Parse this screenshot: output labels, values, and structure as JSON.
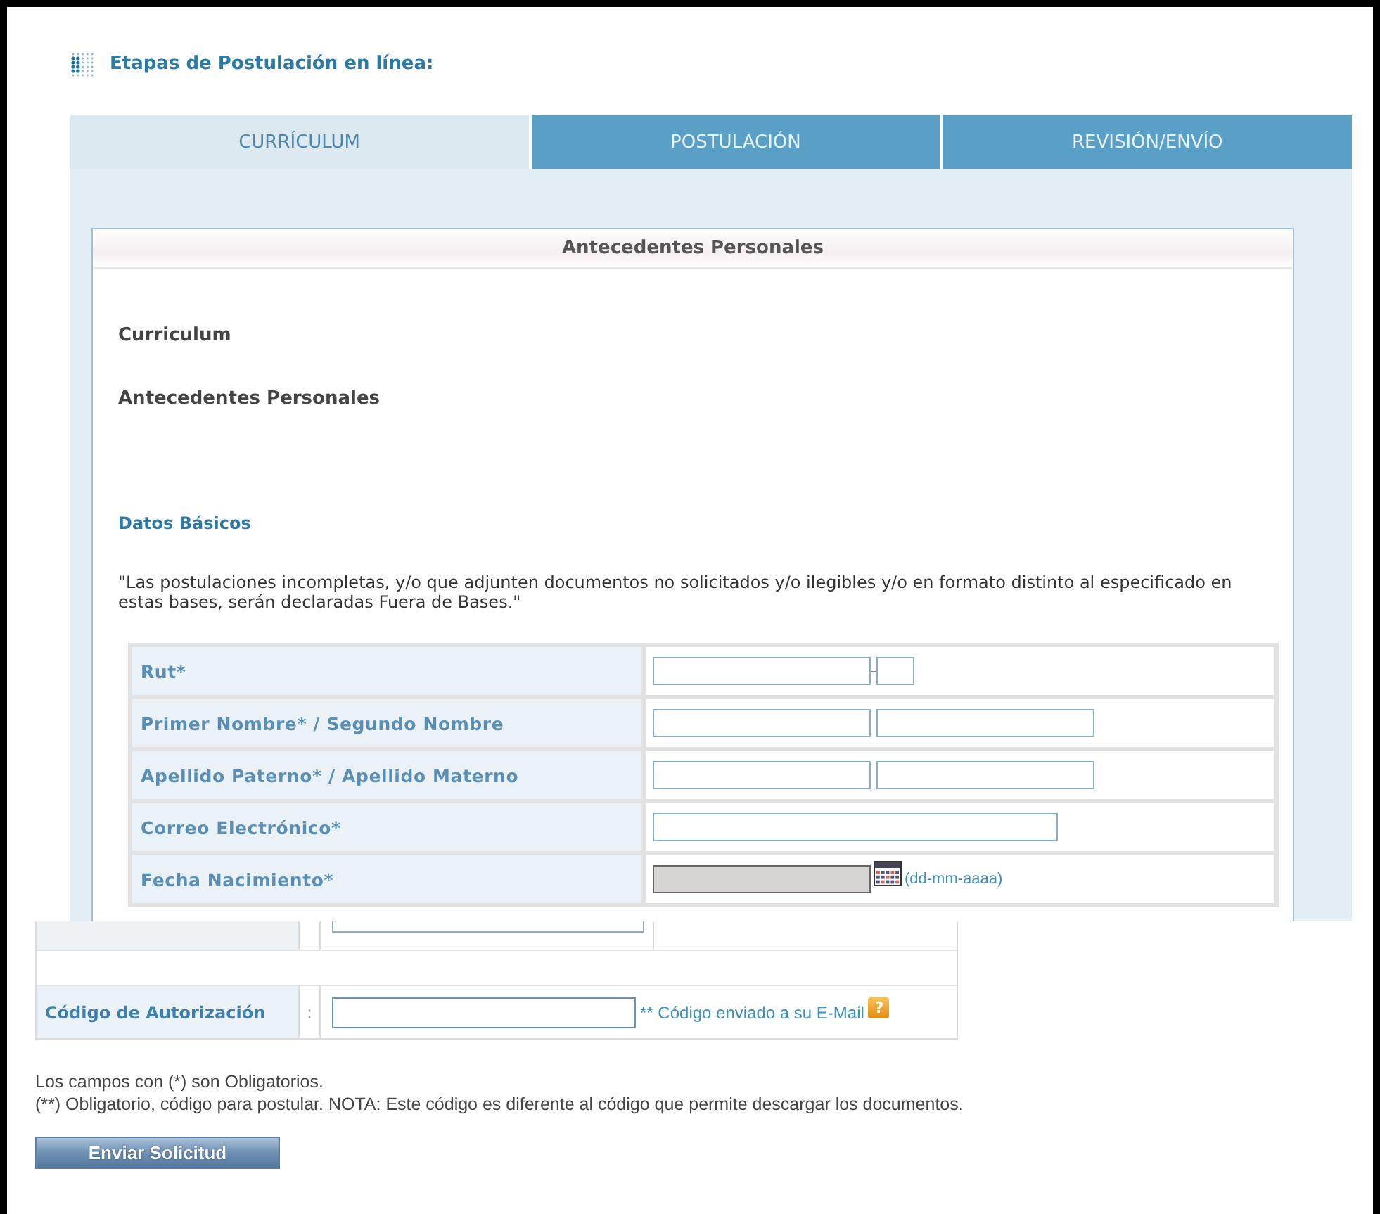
{
  "title": "Etapas de Postulación en línea:",
  "tabs": [
    {
      "label": "CURRÍCULUM",
      "selected": true
    },
    {
      "label": "POSTULACIÓN",
      "selected": false
    },
    {
      "label": "REVISIÓN/ENVÍO",
      "selected": false
    }
  ],
  "section_header": "Antecedentes Personales",
  "headings": [
    "Curriculum",
    "Antecedentes Personales"
  ],
  "subsection": "Datos Básicos",
  "notice": "\"Las postulaciones incompletas, y/o que adjunten documentos no solicitados y/o ilegibles y/o en formato distinto al especificado en estas bases, serán declaradas Fuera de Bases.\"",
  "fields": [
    {
      "label": "Rut*",
      "kind": "rut",
      "disabled": false
    },
    {
      "label": "Primer Nombre* / Segundo Nombre",
      "kind": "pair",
      "disabled": false
    },
    {
      "label": "Apellido Paterno* / Apellido Materno",
      "kind": "pair",
      "disabled": false
    },
    {
      "label": "Correo Electrónico*",
      "kind": "single",
      "disabled": false
    },
    {
      "label": "Fecha Nacimiento*",
      "kind": "date",
      "disabled": true,
      "hint": "(dd-mm-aaaa)"
    }
  ],
  "auth_code": {
    "label": "Código de Autorización",
    "separator": ":",
    "hint": "** Código enviado a su E-Mail",
    "help_icon": "?"
  },
  "notes": [
    "Los campos con (*) son Obligatorios.",
    "(**) Obligatorio, código para postular. NOTA: Este código es diferente al código que permite descargar los documentos."
  ],
  "submit_button": "Enviar Solicitud"
}
